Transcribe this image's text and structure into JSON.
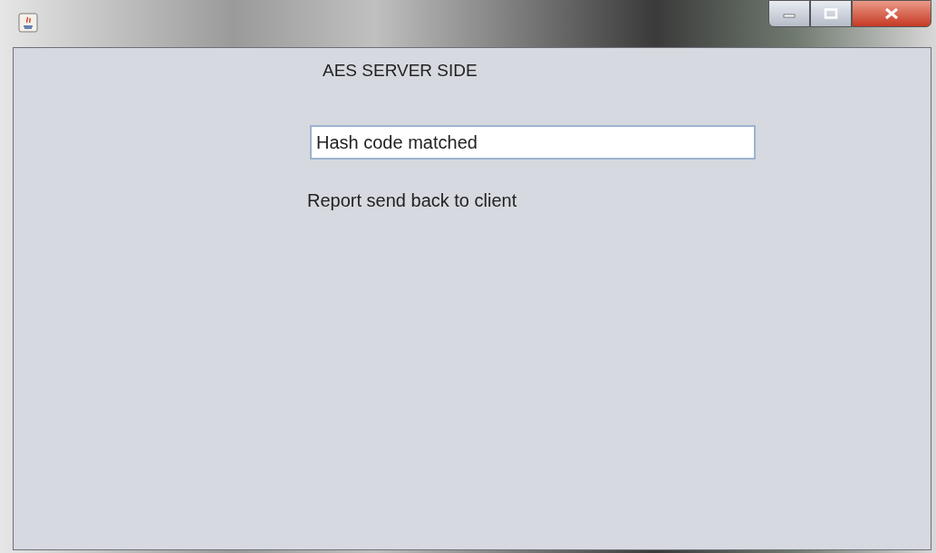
{
  "heading": "AES SERVER SIDE",
  "hash_field": {
    "value": "Hash code matched"
  },
  "status_text": "Report send back to client"
}
